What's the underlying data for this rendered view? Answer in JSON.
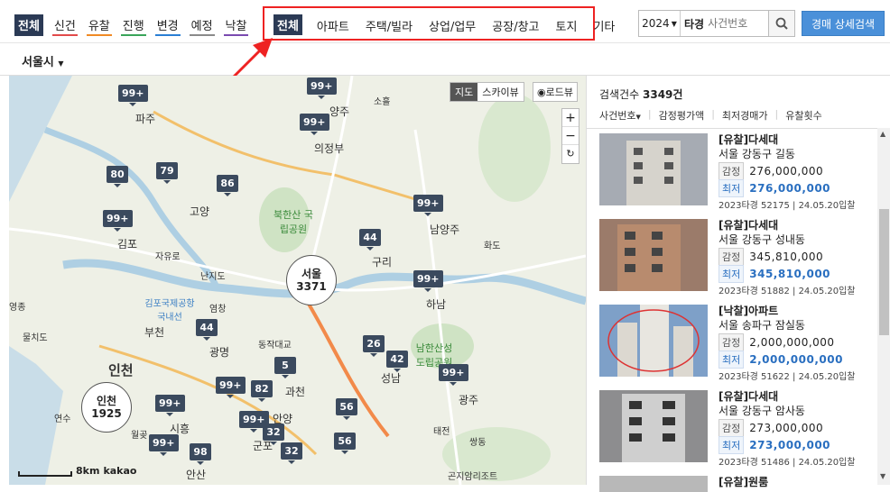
{
  "filters": [
    {
      "label": "전체",
      "active": true,
      "color": "#2b3a55"
    },
    {
      "label": "신건",
      "color": "#e24a4a"
    },
    {
      "label": "유찰",
      "color": "#f08a24"
    },
    {
      "label": "진행",
      "color": "#3aa55a"
    },
    {
      "label": "변경",
      "color": "#2a7fd4"
    },
    {
      "label": "예정",
      "color": "#8a8a8a"
    },
    {
      "label": "낙찰",
      "color": "#7a4ab0"
    }
  ],
  "types": [
    {
      "label": "전체",
      "active": true
    },
    {
      "label": "아파트"
    },
    {
      "label": "주택/빌라"
    },
    {
      "label": "상업/업무"
    },
    {
      "label": "공장/창고"
    },
    {
      "label": "토지"
    },
    {
      "label": "기타"
    }
  ],
  "search": {
    "year": "2024",
    "court": "타경",
    "placeholder": "사건번호",
    "icon": "search-icon"
  },
  "advanced_button": "경매 상세검색",
  "region": "서울시",
  "map": {
    "type_buttons": [
      "지도",
      "스카이뷰"
    ],
    "roadview": "로드뷰",
    "zoom_in": "+",
    "zoom_out": "−",
    "reset": "↻",
    "scale": "8km",
    "provider": "kakao",
    "clusters": [
      {
        "label": "서울",
        "count": "3371"
      },
      {
        "label": "인천",
        "count": "1925"
      }
    ],
    "markers": [
      "99+",
      "99+",
      "99+",
      "80",
      "79",
      "86",
      "99+",
      "99+",
      "44",
      "99+",
      "44",
      "26",
      "42",
      "5",
      "99+",
      "82",
      "99+",
      "99+",
      "32",
      "99+",
      "56",
      "98",
      "32",
      "56",
      "99+"
    ],
    "places": [
      "파주",
      "양주",
      "의정부",
      "고양",
      "김포",
      "남양주",
      "구리",
      "하남",
      "부천",
      "광명",
      "인천",
      "과천",
      "성남",
      "광주",
      "시흥",
      "안양",
      "군포",
      "안산",
      "북한산 국립공원",
      "남한산성 도립공원",
      "자유로",
      "난지도",
      "김포국제공항 국내선",
      "동작대교",
      "곤지암리조트",
      "연수",
      "월곶",
      "화도",
      "태전",
      "쌍동",
      "물치도",
      "소흘",
      "염창",
      "영종"
    ]
  },
  "results": {
    "count_label": "검색건수",
    "count": "3349건",
    "sorts": [
      "사건번호",
      "감정평가액",
      "최저경매가",
      "유찰횟수"
    ],
    "items": [
      {
        "title": "[유찰]다세대",
        "addr": "서울 강동구 길동",
        "appraisal_label": "감정",
        "appraisal": "276,000,000",
        "min_label": "최저",
        "min": "276,000,000",
        "meta": "2023타경 52175 | 24.05.20입찰",
        "thumb_color": "#a6abb3"
      },
      {
        "title": "[유찰]다세대",
        "addr": "서울 강동구 성내동",
        "appraisal_label": "감정",
        "appraisal": "345,810,000",
        "min_label": "최저",
        "min": "345,810,000",
        "meta": "2023타경 51882 | 24.05.20입찰",
        "thumb_color": "#9b7b6a"
      },
      {
        "title": "[낙찰]아파트",
        "addr": "서울 송파구 잠실동",
        "appraisal_label": "감정",
        "appraisal": "2,000,000,000",
        "min_label": "최저",
        "min": "2,000,000,000",
        "meta": "2023타경 51622 | 24.05.20입찰",
        "thumb_color": "#7ea0c8"
      },
      {
        "title": "[유찰]다세대",
        "addr": "서울 강동구 암사동",
        "appraisal_label": "감정",
        "appraisal": "273,000,000",
        "min_label": "최저",
        "min": "273,000,000",
        "meta": "2023타경 51486 | 24.05.20입찰",
        "thumb_color": "#8d8d8f"
      },
      {
        "title": "[유찰]원룸"
      }
    ]
  }
}
